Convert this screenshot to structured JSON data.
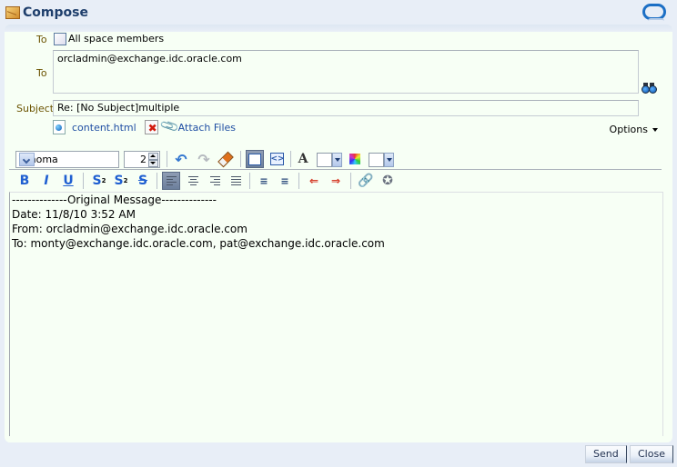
{
  "title": "Compose",
  "form": {
    "to_label_1": "To",
    "all_members_label": "All space members",
    "all_members_checked": false,
    "to_label_2": "To",
    "to_value": "orcladmin@exchange.idc.oracle.com",
    "subject_label": "Subject",
    "subject_value": "Re: [No Subject]multiple",
    "attachment_name": "content.html",
    "attach_files_label": "Attach Files",
    "options_label": "Options"
  },
  "toolbar": {
    "font_family": "Tahoma",
    "font_size": "2",
    "bold": "B",
    "italic": "I",
    "underline": "U",
    "subscript": "S",
    "superscript": "S",
    "strike": "S"
  },
  "body_lines": [
    "--------------Original Message--------------",
    "Date: 11/8/10 3:52 AM",
    "From: orcladmin@exchange.idc.oracle.com",
    "To: monty@exchange.idc.oracle.com, pat@exchange.idc.oracle.com"
  ],
  "buttons": {
    "send": "Send",
    "close": "Close"
  }
}
